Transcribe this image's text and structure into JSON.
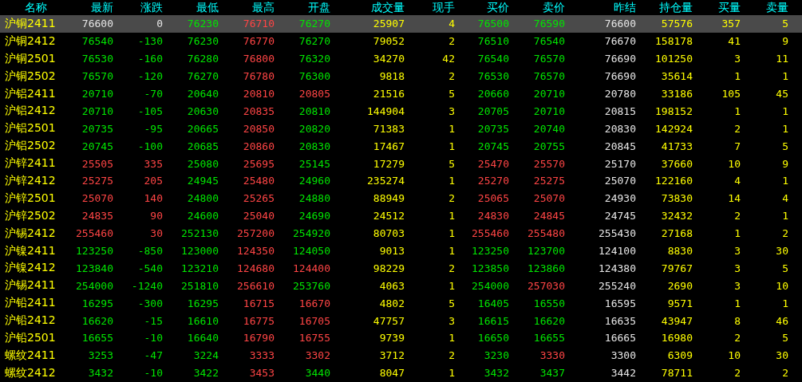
{
  "table": {
    "columns": [
      "名称",
      "最新",
      "涨跌",
      "最低",
      "最高",
      "开盘",
      "成交量",
      "现手",
      "买价",
      "卖价",
      "昨结",
      "持仓量",
      "买量",
      "卖量"
    ],
    "rows": [
      {
        "selected": true,
        "cells": [
          {
            "text": "沪铜2411",
            "color": "#ffff00"
          },
          {
            "text": "76600",
            "color": "#e6e6e6"
          },
          {
            "text": "0",
            "color": "#e6e6e6"
          },
          {
            "text": "76230",
            "color": "#00e600"
          },
          {
            "text": "76710",
            "color": "#ff4545"
          },
          {
            "text": "76270",
            "color": "#00e600"
          },
          {
            "text": "25907",
            "color": "#ffff00"
          },
          {
            "text": "4",
            "color": "#ffff00"
          },
          {
            "text": "76500",
            "color": "#00e600"
          },
          {
            "text": "76590",
            "color": "#00e600"
          },
          {
            "text": "76600",
            "color": "#e6e6e6"
          },
          {
            "text": "57576",
            "color": "#ffff00"
          },
          {
            "text": "357",
            "color": "#ffff00"
          },
          {
            "text": "5",
            "color": "#ffff00"
          }
        ]
      },
      {
        "selected": false,
        "cells": [
          {
            "text": "沪铜2412",
            "color": "#ffff00"
          },
          {
            "text": "76540",
            "color": "#00e600"
          },
          {
            "text": "-130",
            "color": "#00e600"
          },
          {
            "text": "76230",
            "color": "#00e600"
          },
          {
            "text": "76770",
            "color": "#ff4545"
          },
          {
            "text": "76270",
            "color": "#00e600"
          },
          {
            "text": "79052",
            "color": "#ffff00"
          },
          {
            "text": "2",
            "color": "#ffff00"
          },
          {
            "text": "76510",
            "color": "#00e600"
          },
          {
            "text": "76540",
            "color": "#00e600"
          },
          {
            "text": "76670",
            "color": "#e6e6e6"
          },
          {
            "text": "158178",
            "color": "#ffff00"
          },
          {
            "text": "41",
            "color": "#ffff00"
          },
          {
            "text": "9",
            "color": "#ffff00"
          }
        ]
      },
      {
        "selected": false,
        "cells": [
          {
            "text": "沪铜2501",
            "color": "#ffff00"
          },
          {
            "text": "76530",
            "color": "#00e600"
          },
          {
            "text": "-160",
            "color": "#00e600"
          },
          {
            "text": "76280",
            "color": "#00e600"
          },
          {
            "text": "76800",
            "color": "#ff4545"
          },
          {
            "text": "76320",
            "color": "#00e600"
          },
          {
            "text": "34270",
            "color": "#ffff00"
          },
          {
            "text": "42",
            "color": "#ffff00"
          },
          {
            "text": "76540",
            "color": "#00e600"
          },
          {
            "text": "76570",
            "color": "#00e600"
          },
          {
            "text": "76690",
            "color": "#e6e6e6"
          },
          {
            "text": "101250",
            "color": "#ffff00"
          },
          {
            "text": "3",
            "color": "#ffff00"
          },
          {
            "text": "11",
            "color": "#ffff00"
          }
        ]
      },
      {
        "selected": false,
        "cells": [
          {
            "text": "沪铜2502",
            "color": "#ffff00"
          },
          {
            "text": "76570",
            "color": "#00e600"
          },
          {
            "text": "-120",
            "color": "#00e600"
          },
          {
            "text": "76270",
            "color": "#00e600"
          },
          {
            "text": "76780",
            "color": "#ff4545"
          },
          {
            "text": "76300",
            "color": "#00e600"
          },
          {
            "text": "9818",
            "color": "#ffff00"
          },
          {
            "text": "2",
            "color": "#ffff00"
          },
          {
            "text": "76530",
            "color": "#00e600"
          },
          {
            "text": "76570",
            "color": "#00e600"
          },
          {
            "text": "76690",
            "color": "#e6e6e6"
          },
          {
            "text": "35614",
            "color": "#ffff00"
          },
          {
            "text": "1",
            "color": "#ffff00"
          },
          {
            "text": "1",
            "color": "#ffff00"
          }
        ]
      },
      {
        "selected": false,
        "cells": [
          {
            "text": "沪铝2411",
            "color": "#ffff00"
          },
          {
            "text": "20710",
            "color": "#00e600"
          },
          {
            "text": "-70",
            "color": "#00e600"
          },
          {
            "text": "20640",
            "color": "#00e600"
          },
          {
            "text": "20810",
            "color": "#ff4545"
          },
          {
            "text": "20805",
            "color": "#ff4545"
          },
          {
            "text": "21516",
            "color": "#ffff00"
          },
          {
            "text": "5",
            "color": "#ffff00"
          },
          {
            "text": "20660",
            "color": "#00e600"
          },
          {
            "text": "20710",
            "color": "#00e600"
          },
          {
            "text": "20780",
            "color": "#e6e6e6"
          },
          {
            "text": "33186",
            "color": "#ffff00"
          },
          {
            "text": "105",
            "color": "#ffff00"
          },
          {
            "text": "45",
            "color": "#ffff00"
          }
        ]
      },
      {
        "selected": false,
        "cells": [
          {
            "text": "沪铝2412",
            "color": "#ffff00"
          },
          {
            "text": "20710",
            "color": "#00e600"
          },
          {
            "text": "-105",
            "color": "#00e600"
          },
          {
            "text": "20630",
            "color": "#00e600"
          },
          {
            "text": "20835",
            "color": "#ff4545"
          },
          {
            "text": "20810",
            "color": "#00e600"
          },
          {
            "text": "144904",
            "color": "#ffff00"
          },
          {
            "text": "3",
            "color": "#ffff00"
          },
          {
            "text": "20705",
            "color": "#00e600"
          },
          {
            "text": "20710",
            "color": "#00e600"
          },
          {
            "text": "20815",
            "color": "#e6e6e6"
          },
          {
            "text": "198152",
            "color": "#ffff00"
          },
          {
            "text": "1",
            "color": "#ffff00"
          },
          {
            "text": "1",
            "color": "#ffff00"
          }
        ]
      },
      {
        "selected": false,
        "cells": [
          {
            "text": "沪铝2501",
            "color": "#ffff00"
          },
          {
            "text": "20735",
            "color": "#00e600"
          },
          {
            "text": "-95",
            "color": "#00e600"
          },
          {
            "text": "20665",
            "color": "#00e600"
          },
          {
            "text": "20850",
            "color": "#ff4545"
          },
          {
            "text": "20820",
            "color": "#00e600"
          },
          {
            "text": "71383",
            "color": "#ffff00"
          },
          {
            "text": "1",
            "color": "#ffff00"
          },
          {
            "text": "20735",
            "color": "#00e600"
          },
          {
            "text": "20740",
            "color": "#00e600"
          },
          {
            "text": "20830",
            "color": "#e6e6e6"
          },
          {
            "text": "142924",
            "color": "#ffff00"
          },
          {
            "text": "2",
            "color": "#ffff00"
          },
          {
            "text": "1",
            "color": "#ffff00"
          }
        ]
      },
      {
        "selected": false,
        "cells": [
          {
            "text": "沪铝2502",
            "color": "#ffff00"
          },
          {
            "text": "20745",
            "color": "#00e600"
          },
          {
            "text": "-100",
            "color": "#00e600"
          },
          {
            "text": "20685",
            "color": "#00e600"
          },
          {
            "text": "20860",
            "color": "#ff4545"
          },
          {
            "text": "20830",
            "color": "#00e600"
          },
          {
            "text": "17467",
            "color": "#ffff00"
          },
          {
            "text": "1",
            "color": "#ffff00"
          },
          {
            "text": "20745",
            "color": "#00e600"
          },
          {
            "text": "20755",
            "color": "#00e600"
          },
          {
            "text": "20845",
            "color": "#e6e6e6"
          },
          {
            "text": "41733",
            "color": "#ffff00"
          },
          {
            "text": "7",
            "color": "#ffff00"
          },
          {
            "text": "5",
            "color": "#ffff00"
          }
        ]
      },
      {
        "selected": false,
        "cells": [
          {
            "text": "沪锌2411",
            "color": "#ffff00"
          },
          {
            "text": "25505",
            "color": "#ff4545"
          },
          {
            "text": "335",
            "color": "#ff4545"
          },
          {
            "text": "25080",
            "color": "#00e600"
          },
          {
            "text": "25695",
            "color": "#ff4545"
          },
          {
            "text": "25145",
            "color": "#00e600"
          },
          {
            "text": "17279",
            "color": "#ffff00"
          },
          {
            "text": "5",
            "color": "#ffff00"
          },
          {
            "text": "25470",
            "color": "#ff4545"
          },
          {
            "text": "25570",
            "color": "#ff4545"
          },
          {
            "text": "25170",
            "color": "#e6e6e6"
          },
          {
            "text": "37660",
            "color": "#ffff00"
          },
          {
            "text": "10",
            "color": "#ffff00"
          },
          {
            "text": "9",
            "color": "#ffff00"
          }
        ]
      },
      {
        "selected": false,
        "cells": [
          {
            "text": "沪锌2412",
            "color": "#ffff00"
          },
          {
            "text": "25275",
            "color": "#ff4545"
          },
          {
            "text": "205",
            "color": "#ff4545"
          },
          {
            "text": "24945",
            "color": "#00e600"
          },
          {
            "text": "25480",
            "color": "#ff4545"
          },
          {
            "text": "24960",
            "color": "#00e600"
          },
          {
            "text": "235274",
            "color": "#ffff00"
          },
          {
            "text": "1",
            "color": "#ffff00"
          },
          {
            "text": "25270",
            "color": "#ff4545"
          },
          {
            "text": "25275",
            "color": "#ff4545"
          },
          {
            "text": "25070",
            "color": "#e6e6e6"
          },
          {
            "text": "122160",
            "color": "#ffff00"
          },
          {
            "text": "4",
            "color": "#ffff00"
          },
          {
            "text": "1",
            "color": "#ffff00"
          }
        ]
      },
      {
        "selected": false,
        "cells": [
          {
            "text": "沪锌2501",
            "color": "#ffff00"
          },
          {
            "text": "25070",
            "color": "#ff4545"
          },
          {
            "text": "140",
            "color": "#ff4545"
          },
          {
            "text": "24800",
            "color": "#00e600"
          },
          {
            "text": "25265",
            "color": "#ff4545"
          },
          {
            "text": "24880",
            "color": "#00e600"
          },
          {
            "text": "88949",
            "color": "#ffff00"
          },
          {
            "text": "2",
            "color": "#ffff00"
          },
          {
            "text": "25065",
            "color": "#ff4545"
          },
          {
            "text": "25070",
            "color": "#ff4545"
          },
          {
            "text": "24930",
            "color": "#e6e6e6"
          },
          {
            "text": "73830",
            "color": "#ffff00"
          },
          {
            "text": "14",
            "color": "#ffff00"
          },
          {
            "text": "4",
            "color": "#ffff00"
          }
        ]
      },
      {
        "selected": false,
        "cells": [
          {
            "text": "沪锌2502",
            "color": "#ffff00"
          },
          {
            "text": "24835",
            "color": "#ff4545"
          },
          {
            "text": "90",
            "color": "#ff4545"
          },
          {
            "text": "24600",
            "color": "#00e600"
          },
          {
            "text": "25040",
            "color": "#ff4545"
          },
          {
            "text": "24690",
            "color": "#00e600"
          },
          {
            "text": "24512",
            "color": "#ffff00"
          },
          {
            "text": "1",
            "color": "#ffff00"
          },
          {
            "text": "24830",
            "color": "#ff4545"
          },
          {
            "text": "24845",
            "color": "#ff4545"
          },
          {
            "text": "24745",
            "color": "#e6e6e6"
          },
          {
            "text": "32432",
            "color": "#ffff00"
          },
          {
            "text": "2",
            "color": "#ffff00"
          },
          {
            "text": "1",
            "color": "#ffff00"
          }
        ]
      },
      {
        "selected": false,
        "cells": [
          {
            "text": "沪锡2412",
            "color": "#ffff00"
          },
          {
            "text": "255460",
            "color": "#ff4545"
          },
          {
            "text": "30",
            "color": "#ff4545"
          },
          {
            "text": "252130",
            "color": "#00e600"
          },
          {
            "text": "257200",
            "color": "#ff4545"
          },
          {
            "text": "254920",
            "color": "#00e600"
          },
          {
            "text": "80703",
            "color": "#ffff00"
          },
          {
            "text": "1",
            "color": "#ffff00"
          },
          {
            "text": "255460",
            "color": "#ff4545"
          },
          {
            "text": "255480",
            "color": "#ff4545"
          },
          {
            "text": "255430",
            "color": "#e6e6e6"
          },
          {
            "text": "27168",
            "color": "#ffff00"
          },
          {
            "text": "1",
            "color": "#ffff00"
          },
          {
            "text": "2",
            "color": "#ffff00"
          }
        ]
      },
      {
        "selected": false,
        "cells": [
          {
            "text": "沪镍2411",
            "color": "#ffff00"
          },
          {
            "text": "123250",
            "color": "#00e600"
          },
          {
            "text": "-850",
            "color": "#00e600"
          },
          {
            "text": "123000",
            "color": "#00e600"
          },
          {
            "text": "124350",
            "color": "#ff4545"
          },
          {
            "text": "124050",
            "color": "#00e600"
          },
          {
            "text": "9013",
            "color": "#ffff00"
          },
          {
            "text": "1",
            "color": "#ffff00"
          },
          {
            "text": "123250",
            "color": "#00e600"
          },
          {
            "text": "123700",
            "color": "#00e600"
          },
          {
            "text": "124100",
            "color": "#e6e6e6"
          },
          {
            "text": "8830",
            "color": "#ffff00"
          },
          {
            "text": "3",
            "color": "#ffff00"
          },
          {
            "text": "30",
            "color": "#ffff00"
          }
        ]
      },
      {
        "selected": false,
        "cells": [
          {
            "text": "沪镍2412",
            "color": "#ffff00"
          },
          {
            "text": "123840",
            "color": "#00e600"
          },
          {
            "text": "-540",
            "color": "#00e600"
          },
          {
            "text": "123210",
            "color": "#00e600"
          },
          {
            "text": "124680",
            "color": "#ff4545"
          },
          {
            "text": "124400",
            "color": "#ff4545"
          },
          {
            "text": "98229",
            "color": "#ffff00"
          },
          {
            "text": "2",
            "color": "#ffff00"
          },
          {
            "text": "123850",
            "color": "#00e600"
          },
          {
            "text": "123860",
            "color": "#00e600"
          },
          {
            "text": "124380",
            "color": "#e6e6e6"
          },
          {
            "text": "79767",
            "color": "#ffff00"
          },
          {
            "text": "3",
            "color": "#ffff00"
          },
          {
            "text": "5",
            "color": "#ffff00"
          }
        ]
      },
      {
        "selected": false,
        "cells": [
          {
            "text": "沪锡2411",
            "color": "#ffff00"
          },
          {
            "text": "254000",
            "color": "#00e600"
          },
          {
            "text": "-1240",
            "color": "#00e600"
          },
          {
            "text": "251810",
            "color": "#00e600"
          },
          {
            "text": "256610",
            "color": "#ff4545"
          },
          {
            "text": "253760",
            "color": "#00e600"
          },
          {
            "text": "4063",
            "color": "#ffff00"
          },
          {
            "text": "1",
            "color": "#ffff00"
          },
          {
            "text": "254000",
            "color": "#00e600"
          },
          {
            "text": "257030",
            "color": "#ff4545"
          },
          {
            "text": "255240",
            "color": "#e6e6e6"
          },
          {
            "text": "2690",
            "color": "#ffff00"
          },
          {
            "text": "3",
            "color": "#ffff00"
          },
          {
            "text": "10",
            "color": "#ffff00"
          }
        ]
      },
      {
        "selected": false,
        "cells": [
          {
            "text": "沪铅2411",
            "color": "#ffff00"
          },
          {
            "text": "16295",
            "color": "#00e600"
          },
          {
            "text": "-300",
            "color": "#00e600"
          },
          {
            "text": "16295",
            "color": "#00e600"
          },
          {
            "text": "16715",
            "color": "#ff4545"
          },
          {
            "text": "16670",
            "color": "#ff4545"
          },
          {
            "text": "4802",
            "color": "#ffff00"
          },
          {
            "text": "5",
            "color": "#ffff00"
          },
          {
            "text": "16405",
            "color": "#00e600"
          },
          {
            "text": "16550",
            "color": "#00e600"
          },
          {
            "text": "16595",
            "color": "#e6e6e6"
          },
          {
            "text": "9571",
            "color": "#ffff00"
          },
          {
            "text": "1",
            "color": "#ffff00"
          },
          {
            "text": "1",
            "color": "#ffff00"
          }
        ]
      },
      {
        "selected": false,
        "cells": [
          {
            "text": "沪铅2412",
            "color": "#ffff00"
          },
          {
            "text": "16620",
            "color": "#00e600"
          },
          {
            "text": "-15",
            "color": "#00e600"
          },
          {
            "text": "16610",
            "color": "#00e600"
          },
          {
            "text": "16775",
            "color": "#ff4545"
          },
          {
            "text": "16705",
            "color": "#ff4545"
          },
          {
            "text": "47757",
            "color": "#ffff00"
          },
          {
            "text": "3",
            "color": "#ffff00"
          },
          {
            "text": "16615",
            "color": "#00e600"
          },
          {
            "text": "16620",
            "color": "#00e600"
          },
          {
            "text": "16635",
            "color": "#e6e6e6"
          },
          {
            "text": "43947",
            "color": "#ffff00"
          },
          {
            "text": "8",
            "color": "#ffff00"
          },
          {
            "text": "46",
            "color": "#ffff00"
          }
        ]
      },
      {
        "selected": false,
        "cells": [
          {
            "text": "沪铅2501",
            "color": "#ffff00"
          },
          {
            "text": "16655",
            "color": "#00e600"
          },
          {
            "text": "-10",
            "color": "#00e600"
          },
          {
            "text": "16640",
            "color": "#00e600"
          },
          {
            "text": "16790",
            "color": "#ff4545"
          },
          {
            "text": "16755",
            "color": "#ff4545"
          },
          {
            "text": "9739",
            "color": "#ffff00"
          },
          {
            "text": "1",
            "color": "#ffff00"
          },
          {
            "text": "16650",
            "color": "#00e600"
          },
          {
            "text": "16655",
            "color": "#00e600"
          },
          {
            "text": "16665",
            "color": "#e6e6e6"
          },
          {
            "text": "16980",
            "color": "#ffff00"
          },
          {
            "text": "2",
            "color": "#ffff00"
          },
          {
            "text": "5",
            "color": "#ffff00"
          }
        ]
      },
      {
        "selected": false,
        "cells": [
          {
            "text": "螺纹2411",
            "color": "#ffff00"
          },
          {
            "text": "3253",
            "color": "#00e600"
          },
          {
            "text": "-47",
            "color": "#00e600"
          },
          {
            "text": "3224",
            "color": "#00e600"
          },
          {
            "text": "3333",
            "color": "#ff4545"
          },
          {
            "text": "3302",
            "color": "#ff4545"
          },
          {
            "text": "3712",
            "color": "#ffff00"
          },
          {
            "text": "2",
            "color": "#ffff00"
          },
          {
            "text": "3230",
            "color": "#00e600"
          },
          {
            "text": "3330",
            "color": "#ff4545"
          },
          {
            "text": "3300",
            "color": "#e6e6e6"
          },
          {
            "text": "6309",
            "color": "#ffff00"
          },
          {
            "text": "10",
            "color": "#ffff00"
          },
          {
            "text": "30",
            "color": "#ffff00"
          }
        ]
      },
      {
        "selected": false,
        "cells": [
          {
            "text": "螺纹2412",
            "color": "#ffff00"
          },
          {
            "text": "3432",
            "color": "#00e600"
          },
          {
            "text": "-10",
            "color": "#00e600"
          },
          {
            "text": "3422",
            "color": "#00e600"
          },
          {
            "text": "3453",
            "color": "#ff4545"
          },
          {
            "text": "3440",
            "color": "#00e600"
          },
          {
            "text": "8047",
            "color": "#ffff00"
          },
          {
            "text": "1",
            "color": "#ffff00"
          },
          {
            "text": "3432",
            "color": "#00e600"
          },
          {
            "text": "3437",
            "color": "#00e600"
          },
          {
            "text": "3442",
            "color": "#e6e6e6"
          },
          {
            "text": "78711",
            "color": "#ffff00"
          },
          {
            "text": "2",
            "color": "#ffff00"
          },
          {
            "text": "2",
            "color": "#ffff00"
          }
        ]
      }
    ]
  }
}
